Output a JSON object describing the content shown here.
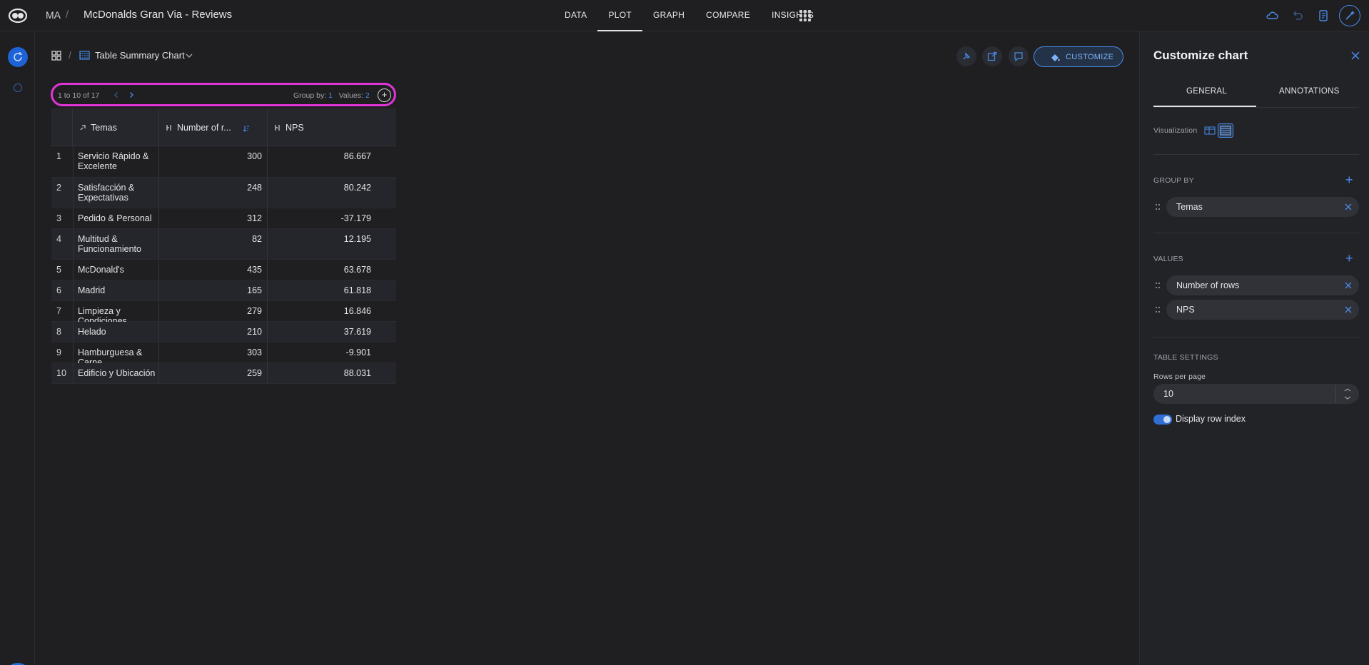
{
  "header": {
    "org": "MA",
    "separator": "/",
    "title": "McDonalds Gran Via - Reviews",
    "nav_tabs": [
      {
        "label": "DATA"
      },
      {
        "label": "PLOT"
      },
      {
        "label": "GRAPH"
      },
      {
        "label": "COMPARE"
      },
      {
        "label": "INSIGHTS"
      }
    ],
    "active_tab": "PLOT",
    "icons": [
      "cloud-icon",
      "undo-icon",
      "notebook-icon",
      "magic-wand-icon"
    ]
  },
  "sidebar": {
    "help_label": "?"
  },
  "chart_header": {
    "separator": "/",
    "title": "Table Summary Chart",
    "customize_label": "CUSTOMIZE"
  },
  "pager": {
    "range": "1 to 10 of 17",
    "group_by_label": "Group by:",
    "group_by_count": "1",
    "values_label": "Values:",
    "values_count": "2",
    "add_label": "+"
  },
  "table": {
    "columns": [
      "Temas",
      "Number of r...",
      "NPS"
    ],
    "rows": [
      {
        "idx": "1",
        "name": "Servicio Rápido & Excelente",
        "count": "300",
        "nps": "86.667"
      },
      {
        "idx": "2",
        "name": "Satisfacción & Expectativas",
        "count": "248",
        "nps": "80.242"
      },
      {
        "idx": "3",
        "name": "Pedido & Personal",
        "count": "312",
        "nps": "-37.179"
      },
      {
        "idx": "4",
        "name": "Multitud & Funcionamiento",
        "count": "82",
        "nps": "12.195"
      },
      {
        "idx": "5",
        "name": "McDonald's",
        "count": "435",
        "nps": "63.678"
      },
      {
        "idx": "6",
        "name": "Madrid",
        "count": "165",
        "nps": "61.818"
      },
      {
        "idx": "7",
        "name": "Limpieza y Condiciones",
        "count": "279",
        "nps": "16.846"
      },
      {
        "idx": "8",
        "name": "Helado",
        "count": "210",
        "nps": "37.619"
      },
      {
        "idx": "9",
        "name": "Hamburguesa & Carne",
        "count": "303",
        "nps": "-9.901"
      },
      {
        "idx": "10",
        "name": "Edificio y Ubicación",
        "count": "259",
        "nps": "88.031"
      }
    ]
  },
  "panel": {
    "title": "Customize chart",
    "tabs": [
      "GENERAL",
      "ANNOTATIONS"
    ],
    "visualization_label": "Visualization",
    "group_by_heading": "GROUP BY",
    "group_by_items": [
      "Temas"
    ],
    "values_heading": "VALUES",
    "values_items": [
      "Number of rows",
      "NPS"
    ],
    "table_settings_heading": "TABLE SETTINGS",
    "rows_per_page_label": "Rows per page",
    "rows_per_page_value": "10",
    "display_row_index_label": "Display row index",
    "display_row_index_on": true
  },
  "colors": {
    "accent": "#4a8be8",
    "highlight_ring": "#e034d6",
    "background": "#1f1f22"
  }
}
